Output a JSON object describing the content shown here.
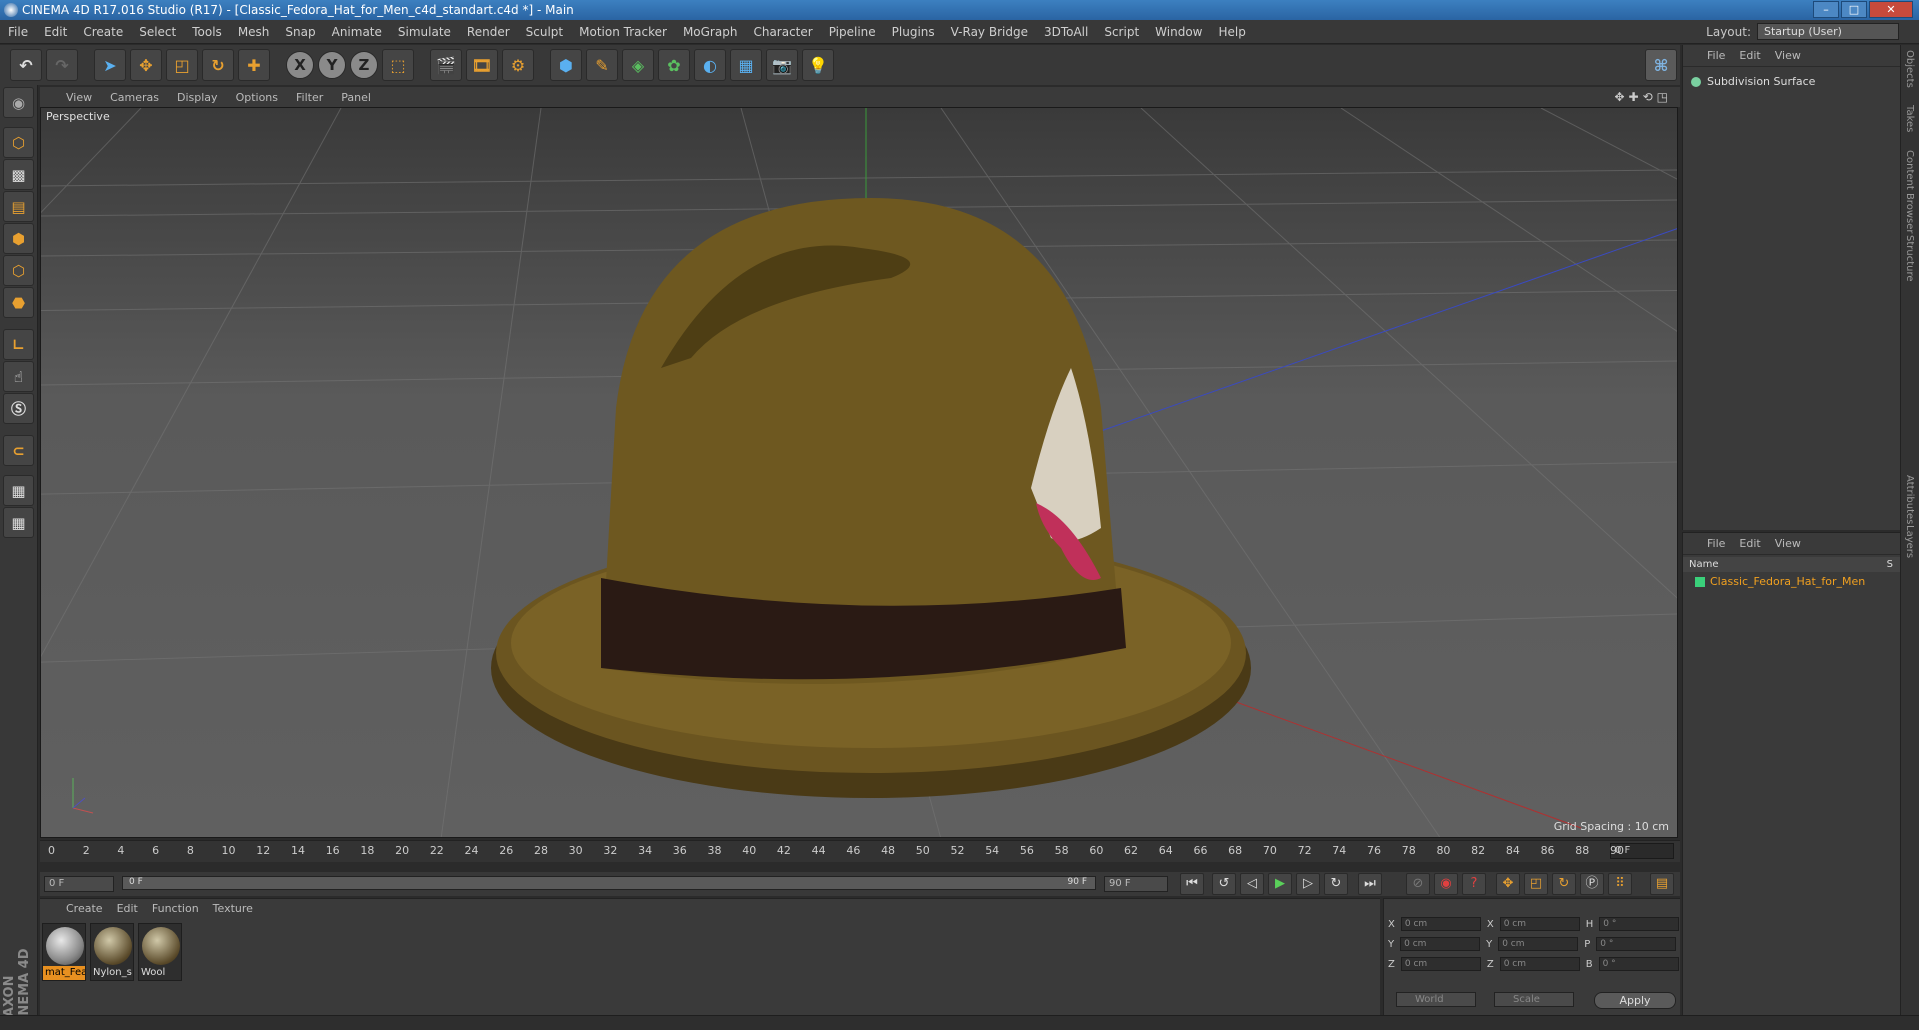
{
  "window": {
    "title": "CINEMA 4D R17.016 Studio (R17) - [Classic_Fedora_Hat_for_Men_c4d_standart.c4d *] - Main"
  },
  "menu": [
    "File",
    "Edit",
    "Create",
    "Select",
    "Tools",
    "Mesh",
    "Snap",
    "Animate",
    "Simulate",
    "Render",
    "Sculpt",
    "Motion Tracker",
    "MoGraph",
    "Character",
    "Pipeline",
    "Plugins",
    "V-Ray Bridge",
    "3DToAll",
    "Script",
    "Window",
    "Help"
  ],
  "layout": {
    "label": "Layout:",
    "value": "Startup (User)"
  },
  "viewport": {
    "menu": [
      "View",
      "Cameras",
      "Display",
      "Options",
      "Filter",
      "Panel"
    ],
    "label": "Perspective",
    "grid_spacing": "Grid Spacing : 10 cm"
  },
  "timeline": {
    "ticks": [
      "0",
      "2",
      "4",
      "6",
      "8",
      "10",
      "12",
      "14",
      "16",
      "18",
      "20",
      "22",
      "24",
      "26",
      "28",
      "30",
      "32",
      "34",
      "36",
      "38",
      "40",
      "42",
      "44",
      "46",
      "48",
      "50",
      "52",
      "54",
      "56",
      "58",
      "60",
      "62",
      "64",
      "66",
      "68",
      "70",
      "72",
      "74",
      "76",
      "78",
      "80",
      "82",
      "84",
      "86",
      "88",
      "90"
    ],
    "current": "0 F"
  },
  "playbar": {
    "start": "0 F",
    "slider_left": "0 F",
    "slider_right": "90 F",
    "end": "90 F"
  },
  "materials": {
    "menu": [
      "Create",
      "Edit",
      "Function",
      "Texture"
    ],
    "items": [
      "mat_Fea",
      "Nylon_s",
      "Wool"
    ]
  },
  "coords": {
    "rows": [
      {
        "a": "X",
        "av": "0 cm",
        "b": "X",
        "bv": "0 cm",
        "c": "H",
        "cv": "0 °"
      },
      {
        "a": "Y",
        "av": "0 cm",
        "b": "Y",
        "bv": "0 cm",
        "c": "P",
        "cv": "0 °"
      },
      {
        "a": "Z",
        "av": "0 cm",
        "b": "Z",
        "bv": "0 cm",
        "c": "B",
        "cv": "0 °"
      }
    ],
    "world": "World",
    "scale": "Scale",
    "apply": "Apply"
  },
  "objects": {
    "menu": [
      "File",
      "Edit",
      "View"
    ],
    "item": "Subdivision Surface"
  },
  "layers": {
    "menu": [
      "File",
      "Edit",
      "View"
    ],
    "name_header": "Name",
    "s_header": "S",
    "item": "Classic_Fedora_Hat_for_Men"
  },
  "side_tabs": [
    "Objects",
    "Takes",
    "Content Browser",
    "Structure",
    "Attributes",
    "Layers"
  ],
  "brand": "MAXON CINEMA 4D"
}
